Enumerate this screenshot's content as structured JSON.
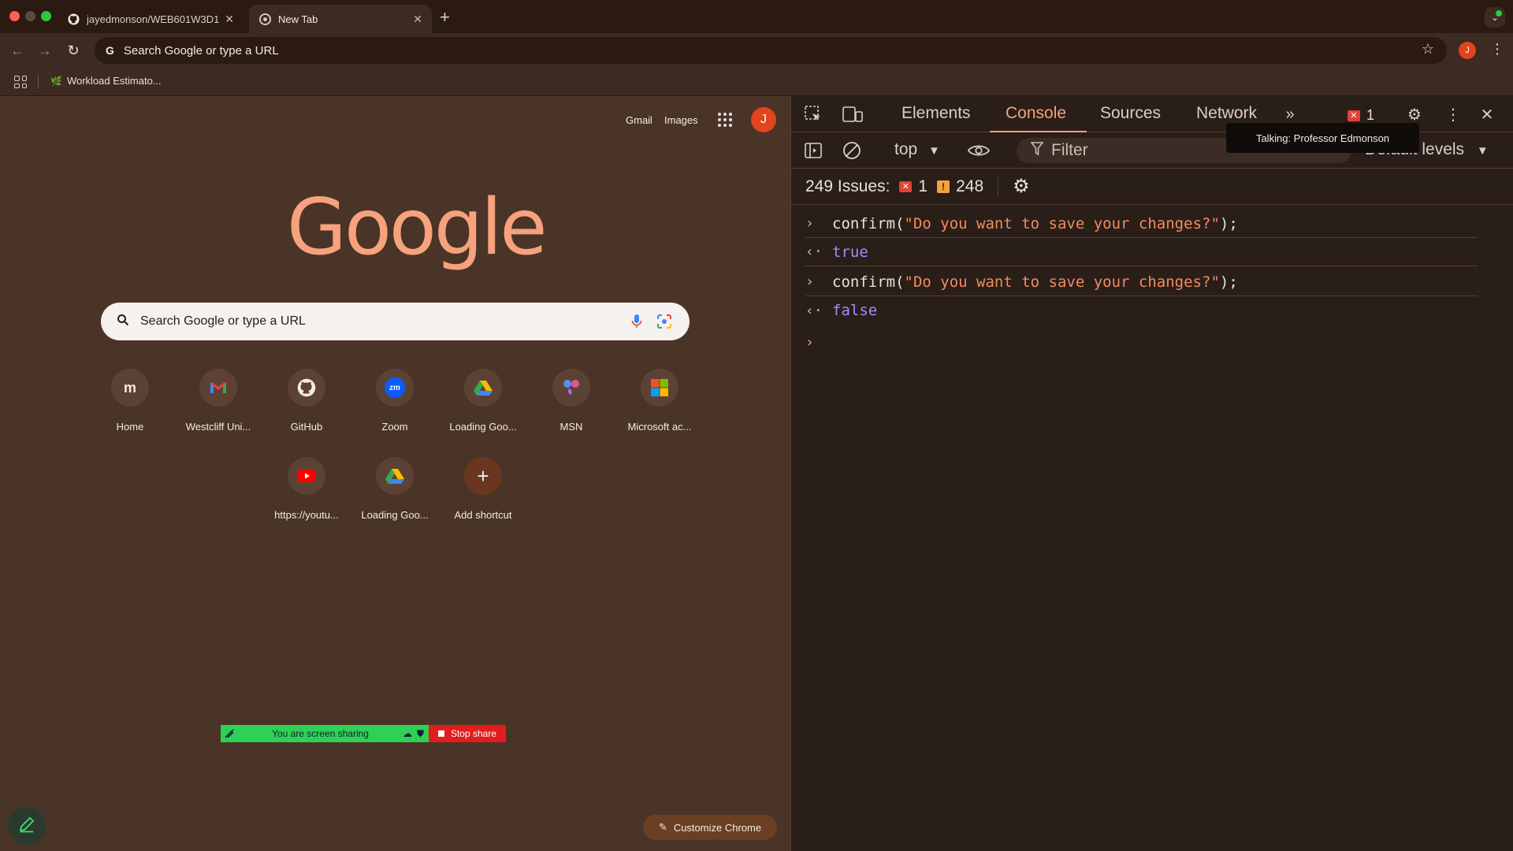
{
  "tabs": [
    {
      "title": "jayedmonson/WEB601W3D1",
      "icon": "github-icon",
      "active": false
    },
    {
      "title": "New Tab",
      "icon": "chrome-icon",
      "active": true
    }
  ],
  "toolbar": {
    "omnibox_text": "Search Google or type a URL",
    "profile_initial": "J"
  },
  "bookmarks": [
    {
      "label": "Workload Estimato..."
    }
  ],
  "ntp": {
    "gmail": "Gmail",
    "images": "Images",
    "avatar_initial": "J",
    "logo": "Google",
    "search_placeholder": "Search Google or type a URL",
    "shortcuts": [
      {
        "label": "Home",
        "icon": "moodle-icon",
        "glyph": "m"
      },
      {
        "label": "Westcliff Uni...",
        "icon": "gmail-icon",
        "glyph": "M"
      },
      {
        "label": "GitHub",
        "icon": "github-icon",
        "glyph": ""
      },
      {
        "label": "Zoom",
        "icon": "zoom-icon",
        "glyph": "zm"
      },
      {
        "label": "Loading Goo...",
        "icon": "google-drive-icon",
        "glyph": ""
      },
      {
        "label": "MSN",
        "icon": "msn-icon",
        "glyph": ""
      },
      {
        "label": "Microsoft ac...",
        "icon": "microsoft-icon",
        "glyph": ""
      },
      {
        "label": "https://youtu...",
        "icon": "youtube-icon",
        "glyph": ""
      },
      {
        "label": "Loading Goo...",
        "icon": "google-drive-icon",
        "glyph": ""
      },
      {
        "label": "Add shortcut",
        "icon": "plus-icon",
        "glyph": "+"
      }
    ],
    "share_status": "You are screen sharing",
    "stop_share": "Stop share",
    "customize": "Customize Chrome"
  },
  "devtools": {
    "tabs": [
      "Elements",
      "Console",
      "Sources",
      "Network"
    ],
    "active_tab": "Console",
    "error_count": "1",
    "context": "top",
    "filter_placeholder": "Filter",
    "levels": "Default levels",
    "issues_label": "249 Issues:",
    "issues_errors": "1",
    "issues_warnings": "248",
    "console_lines": [
      {
        "type": "input",
        "fn": "confirm(",
        "str": "\"Do you want to save your changes?\"",
        "end": ");"
      },
      {
        "type": "output",
        "value": "true"
      },
      {
        "type": "input",
        "fn": "confirm(",
        "str": "\"Do you want to save your changes?\"",
        "end": ");"
      },
      {
        "type": "output",
        "value": "false"
      }
    ]
  },
  "tooltip": "Talking: Professor Edmonson",
  "colors": {
    "page_bg": "#4a3427",
    "accent": "#f6a27d",
    "avatar": "#e3431e",
    "share_green": "#2fd056",
    "stop_red": "#e11d1d"
  }
}
